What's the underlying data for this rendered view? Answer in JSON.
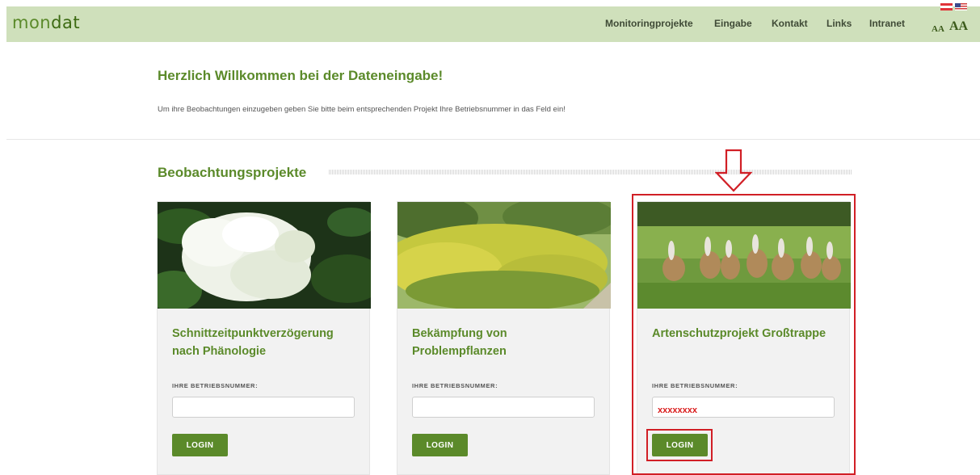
{
  "header": {
    "logo_part1": "mon",
    "logo_part2": "dat",
    "nav": [
      "Monitoringprojekte",
      "Eingabe",
      "Kontakt",
      "Links",
      "Intranet"
    ],
    "font_size_small": "AA",
    "font_size_large": "AA"
  },
  "welcome": {
    "title": "Herzlich Willkommen bei der Dateneingabe!",
    "text": "Um ihre Beobachtungen einzugeben geben Sie bitte beim entsprechenden Projekt Ihre Betriebsnummer in das Feld ein!"
  },
  "section": {
    "title": "Beobachtungsprojekte"
  },
  "cards": [
    {
      "title": "Schnittzeitpunktverzögerung nach Phänologie",
      "field_label": "IHRE BETRIEBSNUMMER:",
      "input_value": "",
      "button_label": "LOGIN",
      "image_icon": "elderflower-photo"
    },
    {
      "title": "Bekämpfung von Problempflanzen",
      "field_label": "IHRE BETRIEBSNUMMER:",
      "input_value": "",
      "button_label": "LOGIN",
      "image_icon": "goldenrod-meadow-photo"
    },
    {
      "title": "Artenschutzprojekt Großtrappe",
      "field_label": "IHRE BETRIEBSNUMMER:",
      "input_value": "xxxxxxxx",
      "button_label": "LOGIN",
      "image_icon": "great-bustards-photo"
    }
  ],
  "colors": {
    "brand_green": "#5b8a2a",
    "header_bg": "#cfe0bb",
    "annotation_red": "#d11f26"
  }
}
